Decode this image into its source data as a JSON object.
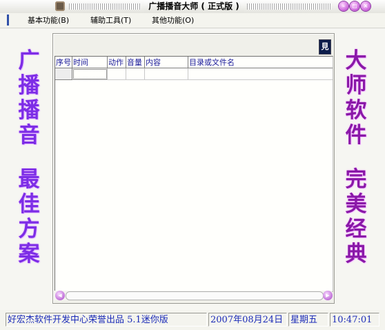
{
  "window": {
    "title": "广播播音大师 ( 正式版 )",
    "buttons": {
      "minimize": "–",
      "maximize": "□",
      "close": "×"
    }
  },
  "menu": [
    {
      "label": "基本功能(B)"
    },
    {
      "label": "辅助工具(T)"
    },
    {
      "label": "其他功能(O)"
    }
  ],
  "slogans": {
    "left_top": [
      "广",
      "播",
      "播",
      "音"
    ],
    "left_bottom": [
      "最",
      "佳",
      "方",
      "案"
    ],
    "right_top": [
      "大",
      "师",
      "软",
      "件"
    ],
    "right_bottom": [
      "完",
      "美",
      "经",
      "典"
    ]
  },
  "panel": {
    "button_glyph": "見",
    "columns": [
      "序号",
      "时间",
      "动作",
      "音量",
      "内容",
      "目录或文件名"
    ]
  },
  "status": {
    "credit": "好宏杰软件开发中心荣誉出品 5.1迷你版",
    "date": "2007年08月24日",
    "weekday": "星期五",
    "time": "10:47:01"
  },
  "colors": {
    "slogan_left": "#7d2de6",
    "slogan_right": "#8a18a8",
    "header_text": "#1a1a9a",
    "status_text": "#1c2cb8"
  }
}
